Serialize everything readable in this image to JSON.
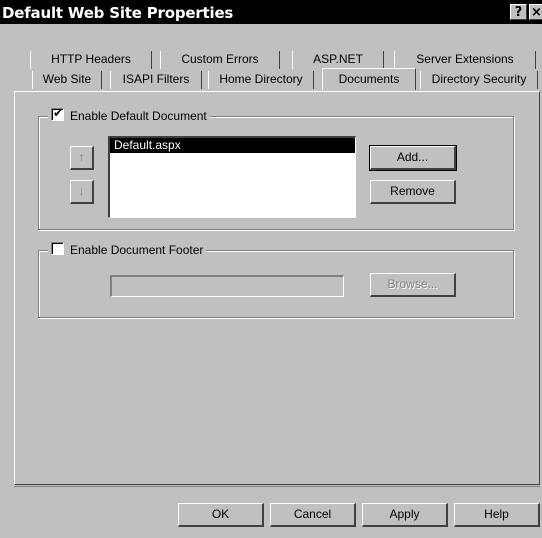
{
  "window": {
    "title": "Default Web Site Properties",
    "help_glyph": "?",
    "close_glyph": "×"
  },
  "tabs": {
    "row1": [
      "HTTP Headers",
      "Custom Errors",
      "ASP.NET",
      "Server Extensions"
    ],
    "row2": [
      "Web Site",
      "ISAPI Filters",
      "Home Directory",
      "Documents",
      "Directory Security"
    ],
    "active": "Documents"
  },
  "default_document": {
    "label": "Enable Default Document",
    "checked": true,
    "check_glyph": "✔",
    "items": [
      "Default.aspx"
    ],
    "selected_item": "Default.aspx",
    "move_up_icon": "↑",
    "move_down_icon": "↓",
    "add_label": "Add...",
    "remove_label": "Remove"
  },
  "document_footer": {
    "label": "Enable Document Footer",
    "checked": false,
    "path_value": "",
    "browse_label": "Browse..."
  },
  "footer_buttons": {
    "ok": "OK",
    "cancel": "Cancel",
    "apply": "Apply",
    "help": "Help"
  }
}
